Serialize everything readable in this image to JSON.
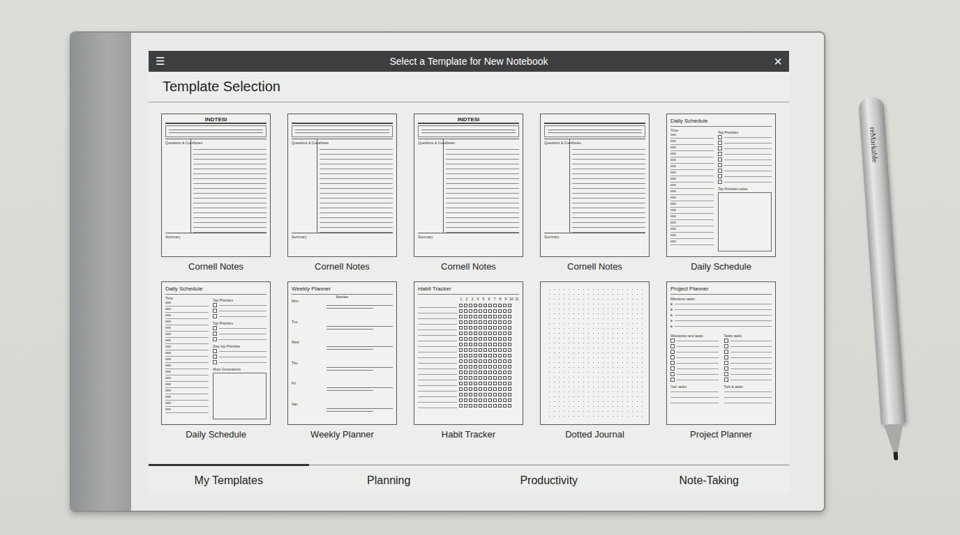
{
  "window": {
    "title": "Select a Template for New Notebook",
    "menu_icon": "☰",
    "close_icon": "×"
  },
  "heading": "Template Selection",
  "templates": [
    {
      "kind": "cornell",
      "label": "Cornell Notes",
      "title": "INDTESI",
      "cue": "Questions & Cues",
      "notes": "Notes",
      "summary": "Summary"
    },
    {
      "kind": "cornell",
      "label": "Cornell Notes",
      "cue": "Questions & Cues",
      "notes": "Notes",
      "summary": "Summary"
    },
    {
      "kind": "cornell",
      "label": "Cornell Notes",
      "title": "INDTESI",
      "cue": "Questions & Cues",
      "notes": "Notes",
      "summary": "Summary"
    },
    {
      "kind": "cornell",
      "label": "Cornell Notes",
      "cue": "Questions & Cues",
      "notes": "Notes",
      "summary": "Summary"
    },
    {
      "kind": "daily",
      "label": "Daily Schedule",
      "title": "Daily Schedule",
      "time": "Time",
      "sections": [
        "Top Priorities",
        "Top Priorities notes"
      ]
    },
    {
      "kind": "daily",
      "label": "Daily Schedule",
      "title": "Daily Schedule",
      "time": "Time",
      "sections": [
        "Top Priorities",
        "Top Priorities",
        "Stay top Priorities",
        "More Generations"
      ]
    },
    {
      "kind": "weekly",
      "label": "Weekly Planner",
      "title": "Weekly Planner",
      "subtitle": "Meetlee",
      "days": [
        "Mon",
        "Tue",
        "Wed",
        "Thu",
        "Fri",
        "San"
      ]
    },
    {
      "kind": "habit",
      "label": "Habit Tracker",
      "title": "Habit Tracker",
      "numbers": [
        "1",
        "2",
        "3",
        "4",
        "5",
        "6",
        "7",
        "8",
        "9",
        "10",
        "11"
      ]
    },
    {
      "kind": "dotted",
      "label": "Dotted Journal"
    },
    {
      "kind": "project",
      "label": "Project Planner",
      "title": "Project Planner",
      "top": "Milestone tasks",
      "left": "Milestones and tasks",
      "right": "Tasks tasks",
      "bottom_left": "Yed. tasks",
      "bottom_right": "Tork & tasks"
    }
  ],
  "tabs": [
    {
      "label": "My Templates",
      "selected": true
    },
    {
      "label": "Planning",
      "selected": false
    },
    {
      "label": "Productivity",
      "selected": false
    },
    {
      "label": "Note-Taking",
      "selected": false
    }
  ],
  "pen": {
    "brand": "reMarkable"
  }
}
